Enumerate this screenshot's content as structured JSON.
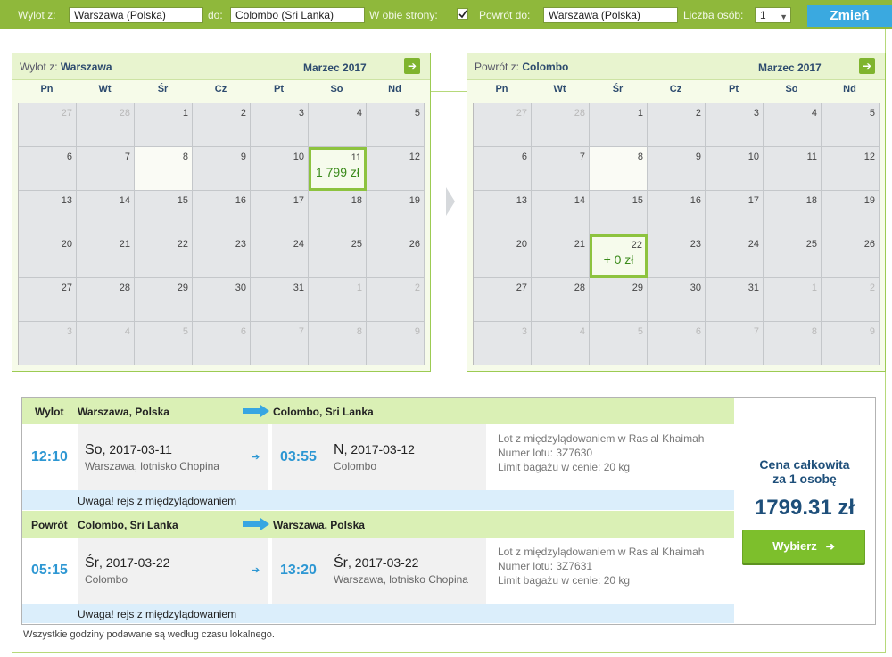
{
  "search": {
    "from_label": "Wylot z:",
    "from_value": "Warszawa (Polska)",
    "to_label": "do:",
    "to_value": "Colombo (Sri Lanka)",
    "roundtrip_label": "W obie strony:",
    "roundtrip_checked": true,
    "return_label": "Powrót do:",
    "return_value": "Warszawa (Polska)",
    "persons_label": "Liczba osób:",
    "persons_value": "1",
    "change_label": "Zmień"
  },
  "weekdays": [
    "Pn",
    "Wt",
    "Śr",
    "Cz",
    "Pt",
    "So",
    "Nd"
  ],
  "outbound_calendar": {
    "title_prefix": "Wylot z:",
    "title_city": "Warszawa",
    "month": "Marzec 2017",
    "next_icon": "arrow-right-icon",
    "selected_day": "11",
    "selected_price": "1 799 zł",
    "rows": [
      [
        "27",
        "28",
        "1",
        "2",
        "3",
        "4",
        "5"
      ],
      [
        "6",
        "7",
        "8",
        "9",
        "10",
        "11",
        "12"
      ],
      [
        "13",
        "14",
        "15",
        "16",
        "17",
        "18",
        "19"
      ],
      [
        "20",
        "21",
        "22",
        "23",
        "24",
        "25",
        "26"
      ],
      [
        "27",
        "28",
        "29",
        "30",
        "31",
        "1",
        "2"
      ],
      [
        "3",
        "4",
        "5",
        "6",
        "7",
        "8",
        "9"
      ]
    ]
  },
  "return_calendar": {
    "title_prefix": "Powrót z:",
    "title_city": "Colombo",
    "month": "Marzec 2017",
    "next_icon": "arrow-right-icon",
    "selected_day": "22",
    "selected_price": "+ 0 zł",
    "rows": [
      [
        "27",
        "28",
        "1",
        "2",
        "3",
        "4",
        "5"
      ],
      [
        "6",
        "7",
        "8",
        "9",
        "10",
        "11",
        "12"
      ],
      [
        "13",
        "14",
        "15",
        "16",
        "17",
        "18",
        "19"
      ],
      [
        "20",
        "21",
        "22",
        "23",
        "24",
        "25",
        "26"
      ],
      [
        "27",
        "28",
        "29",
        "30",
        "31",
        "1",
        "2"
      ],
      [
        "3",
        "4",
        "5",
        "6",
        "7",
        "8",
        "9"
      ]
    ]
  },
  "outbound": {
    "label": "Wylot",
    "from": "Warszawa, Polska",
    "to": "Colombo, Sri Lanka",
    "dep_time": "12:10",
    "dep_day": "So",
    "dep_date": ", 2017-03-11",
    "dep_place": "Warszawa, lotnisko Chopina",
    "arr_time": "03:55",
    "arr_day": "N",
    "arr_date": ", 2017-03-12",
    "arr_place": "Colombo",
    "info_stop": "Lot z międzylądowaniem w Ras al Khaimah",
    "info_flight": "Numer lotu: 3Z7630",
    "info_baggage": "Limit bagażu w cenie: 20 kg",
    "warning": "Uwaga! rejs z międzylądowaniem"
  },
  "inbound": {
    "label": "Powrót",
    "from": "Colombo, Sri Lanka",
    "to": "Warszawa, Polska",
    "dep_time": "05:15",
    "dep_day": "Śr",
    "dep_date": ", 2017-03-22",
    "dep_place": "Colombo",
    "arr_time": "13:20",
    "arr_day": "Śr",
    "arr_date": ", 2017-03-22",
    "arr_place": "Warszawa, lotnisko Chopina",
    "info_stop": "Lot z międzylądowaniem w Ras al Khaimah",
    "info_flight": "Numer lotu: 3Z7631",
    "info_baggage": "Limit bagażu w cenie: 20 kg",
    "warning": "Uwaga! rejs z międzylądowaniem"
  },
  "price": {
    "label_line1": "Cena całkowita",
    "label_line2": "za 1 osobę",
    "total": "1799.31 zł",
    "choose_label": "Wybierz",
    "choose_arrow": "➔"
  },
  "footnote": "Wszystkie godziny podawane są według czasu lokalnego.",
  "colors": {
    "topbar": "#8fb83b",
    "accent_blue": "#2d97d3",
    "accent_green": "#7dbf2c",
    "header_green": "#daf0b5",
    "warning_blue": "#dbeefb"
  }
}
